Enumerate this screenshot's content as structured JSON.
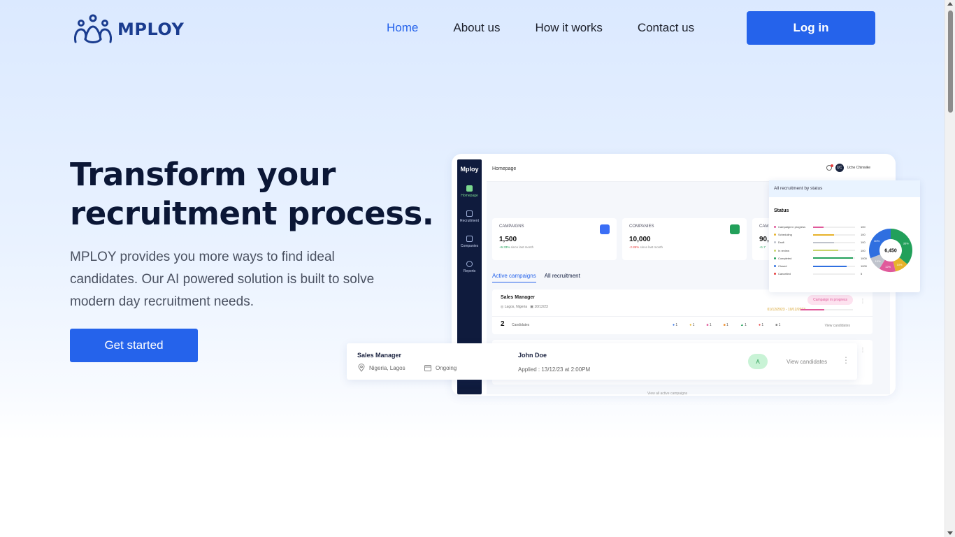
{
  "brand": {
    "name": "MPLOY",
    "logo_icon": "people-group-icon",
    "color": "#1a3c8f"
  },
  "nav": {
    "items": [
      {
        "label": "Home",
        "active": true
      },
      {
        "label": "About us",
        "active": false
      },
      {
        "label": "How it works",
        "active": false
      },
      {
        "label": "Contact us",
        "active": false
      }
    ],
    "login_label": "Log in"
  },
  "hero": {
    "title_line1": "Transform your",
    "title_line2": "recruitment process.",
    "subtitle": "MPLOY provides you more ways to find ideal candidates. Our AI powered solution is built to solve modern day recruitment needs.",
    "cta_label": "Get started"
  },
  "colors": {
    "accent": "#2563eb",
    "text": "#0b1736"
  },
  "dashboard": {
    "brand": "Mploy",
    "page_title": "Homepage",
    "user": {
      "initials": "UC",
      "name": "Uche Chinwike"
    },
    "sidebar": [
      {
        "label": "Homepage",
        "icon": "grid-icon"
      },
      {
        "label": "Recruitment",
        "icon": "book-icon"
      },
      {
        "label": "Companies",
        "icon": "building-icon"
      },
      {
        "label": "Reports",
        "icon": "pie-chart-icon"
      }
    ],
    "stats": [
      {
        "label": "CAMPAIGNS",
        "value": "1,500",
        "change": "+6.33%",
        "change_suffix": "since last month",
        "color": "#3b6ef5"
      },
      {
        "label": "COMPANIES",
        "value": "10,000",
        "change": "-2.86%",
        "change_suffix": "since last month",
        "color": "#22a05a"
      },
      {
        "label": "CAM",
        "value": "90,",
        "change": "+1.7",
        "change_suffix": "",
        "color": "#999"
      }
    ],
    "tabs": [
      "Active campaigns",
      "All recruitment"
    ],
    "campaign": {
      "title": "Sales Manager",
      "location": "Lagos, Nigeria",
      "date": "10/12/23",
      "status": "Campaign in progress",
      "range": "01/12/2023 - 10/12/2023",
      "count": "2",
      "count_label": "Candidates",
      "icon_counts": [
        "1",
        "1",
        "1",
        "1",
        "1",
        "1",
        "1"
      ],
      "view_label": "View candidates",
      "view_all": "View all active campaigns"
    },
    "status_card": {
      "header": "All recruitment by status",
      "title": "Status",
      "total": "6,450",
      "rows": [
        {
          "name": "Campaign in progress",
          "value": "100",
          "fill": 0.25,
          "color": "#e05a9b"
        },
        {
          "name": "Scheduling",
          "value": "100",
          "fill": 0.5,
          "color": "#e7b22a"
        },
        {
          "name": "Draft",
          "value": "100",
          "fill": 0.5,
          "color": "#bfc3cc"
        },
        {
          "name": "In review",
          "value": "100",
          "fill": 0.6,
          "color": "#c7d36a"
        },
        {
          "name": "Completed",
          "value": "1000",
          "fill": 0.95,
          "color": "#22a05a"
        },
        {
          "name": "Closed",
          "value": "1000",
          "fill": 0.8,
          "color": "#2f6fe0"
        },
        {
          "name": "Cancelled",
          "value": "5",
          "fill": 0.0,
          "color": "#e53e3e"
        }
      ],
      "donut": [
        {
          "label": "35%",
          "value": 35,
          "color": "#22a05a"
        },
        {
          "label": "10%",
          "value": 10,
          "color": "#e7b22a"
        },
        {
          "label": "12%",
          "value": 12,
          "color": "#e05a9b"
        },
        {
          "label": "10%",
          "value": 10,
          "color": "#bfc3cc"
        },
        {
          "label": "30%",
          "value": 30,
          "color": "#2f6fe0"
        }
      ]
    }
  },
  "float_card": {
    "title": "Sales Manager",
    "location": "Nigeria, Lagos",
    "status": "Ongoing",
    "candidate": "John Doe",
    "applied": "Applied : 13/12/23 at 2:00PM",
    "badge": "A",
    "view_label": "View candidates"
  }
}
